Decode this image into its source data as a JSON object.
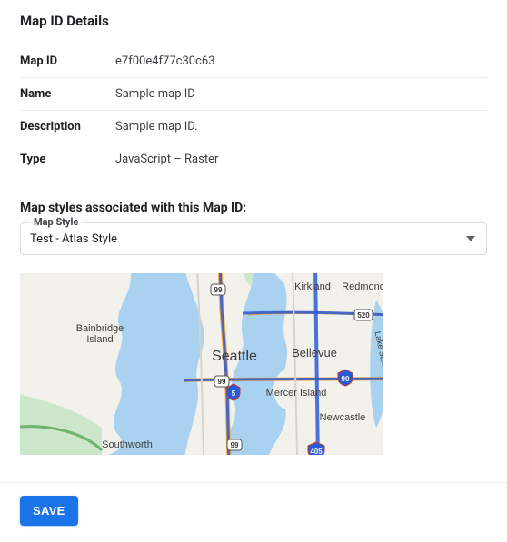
{
  "section_title": "Map ID Details",
  "details": {
    "rows": [
      {
        "label": "Map ID",
        "value": "e7f00e4f77c30c63"
      },
      {
        "label": "Name",
        "value": "Sample map ID"
      },
      {
        "label": "Description",
        "value": "Sample map ID."
      },
      {
        "label": "Type",
        "value": "JavaScript – Raster"
      }
    ]
  },
  "styles": {
    "heading": "Map styles associated with this Map ID:",
    "select_label": "Map Style",
    "selected": "Test - Atlas Style"
  },
  "map_labels": {
    "seattle": "Seattle",
    "bellevue": "Bellevue",
    "kirkland": "Kirkland",
    "redmond": "Redmond",
    "bainbridge1": "Bainbridge",
    "bainbridge2": "Island",
    "mercer": "Mercer Island",
    "newcastle": "Newcastle",
    "southworth": "Southworth",
    "sammamish": "Lake Sammamish",
    "hwy99": "99",
    "i5": "5",
    "i405": "405",
    "i90": "90",
    "sr520": "520"
  },
  "footer": {
    "save": "SAVE"
  }
}
